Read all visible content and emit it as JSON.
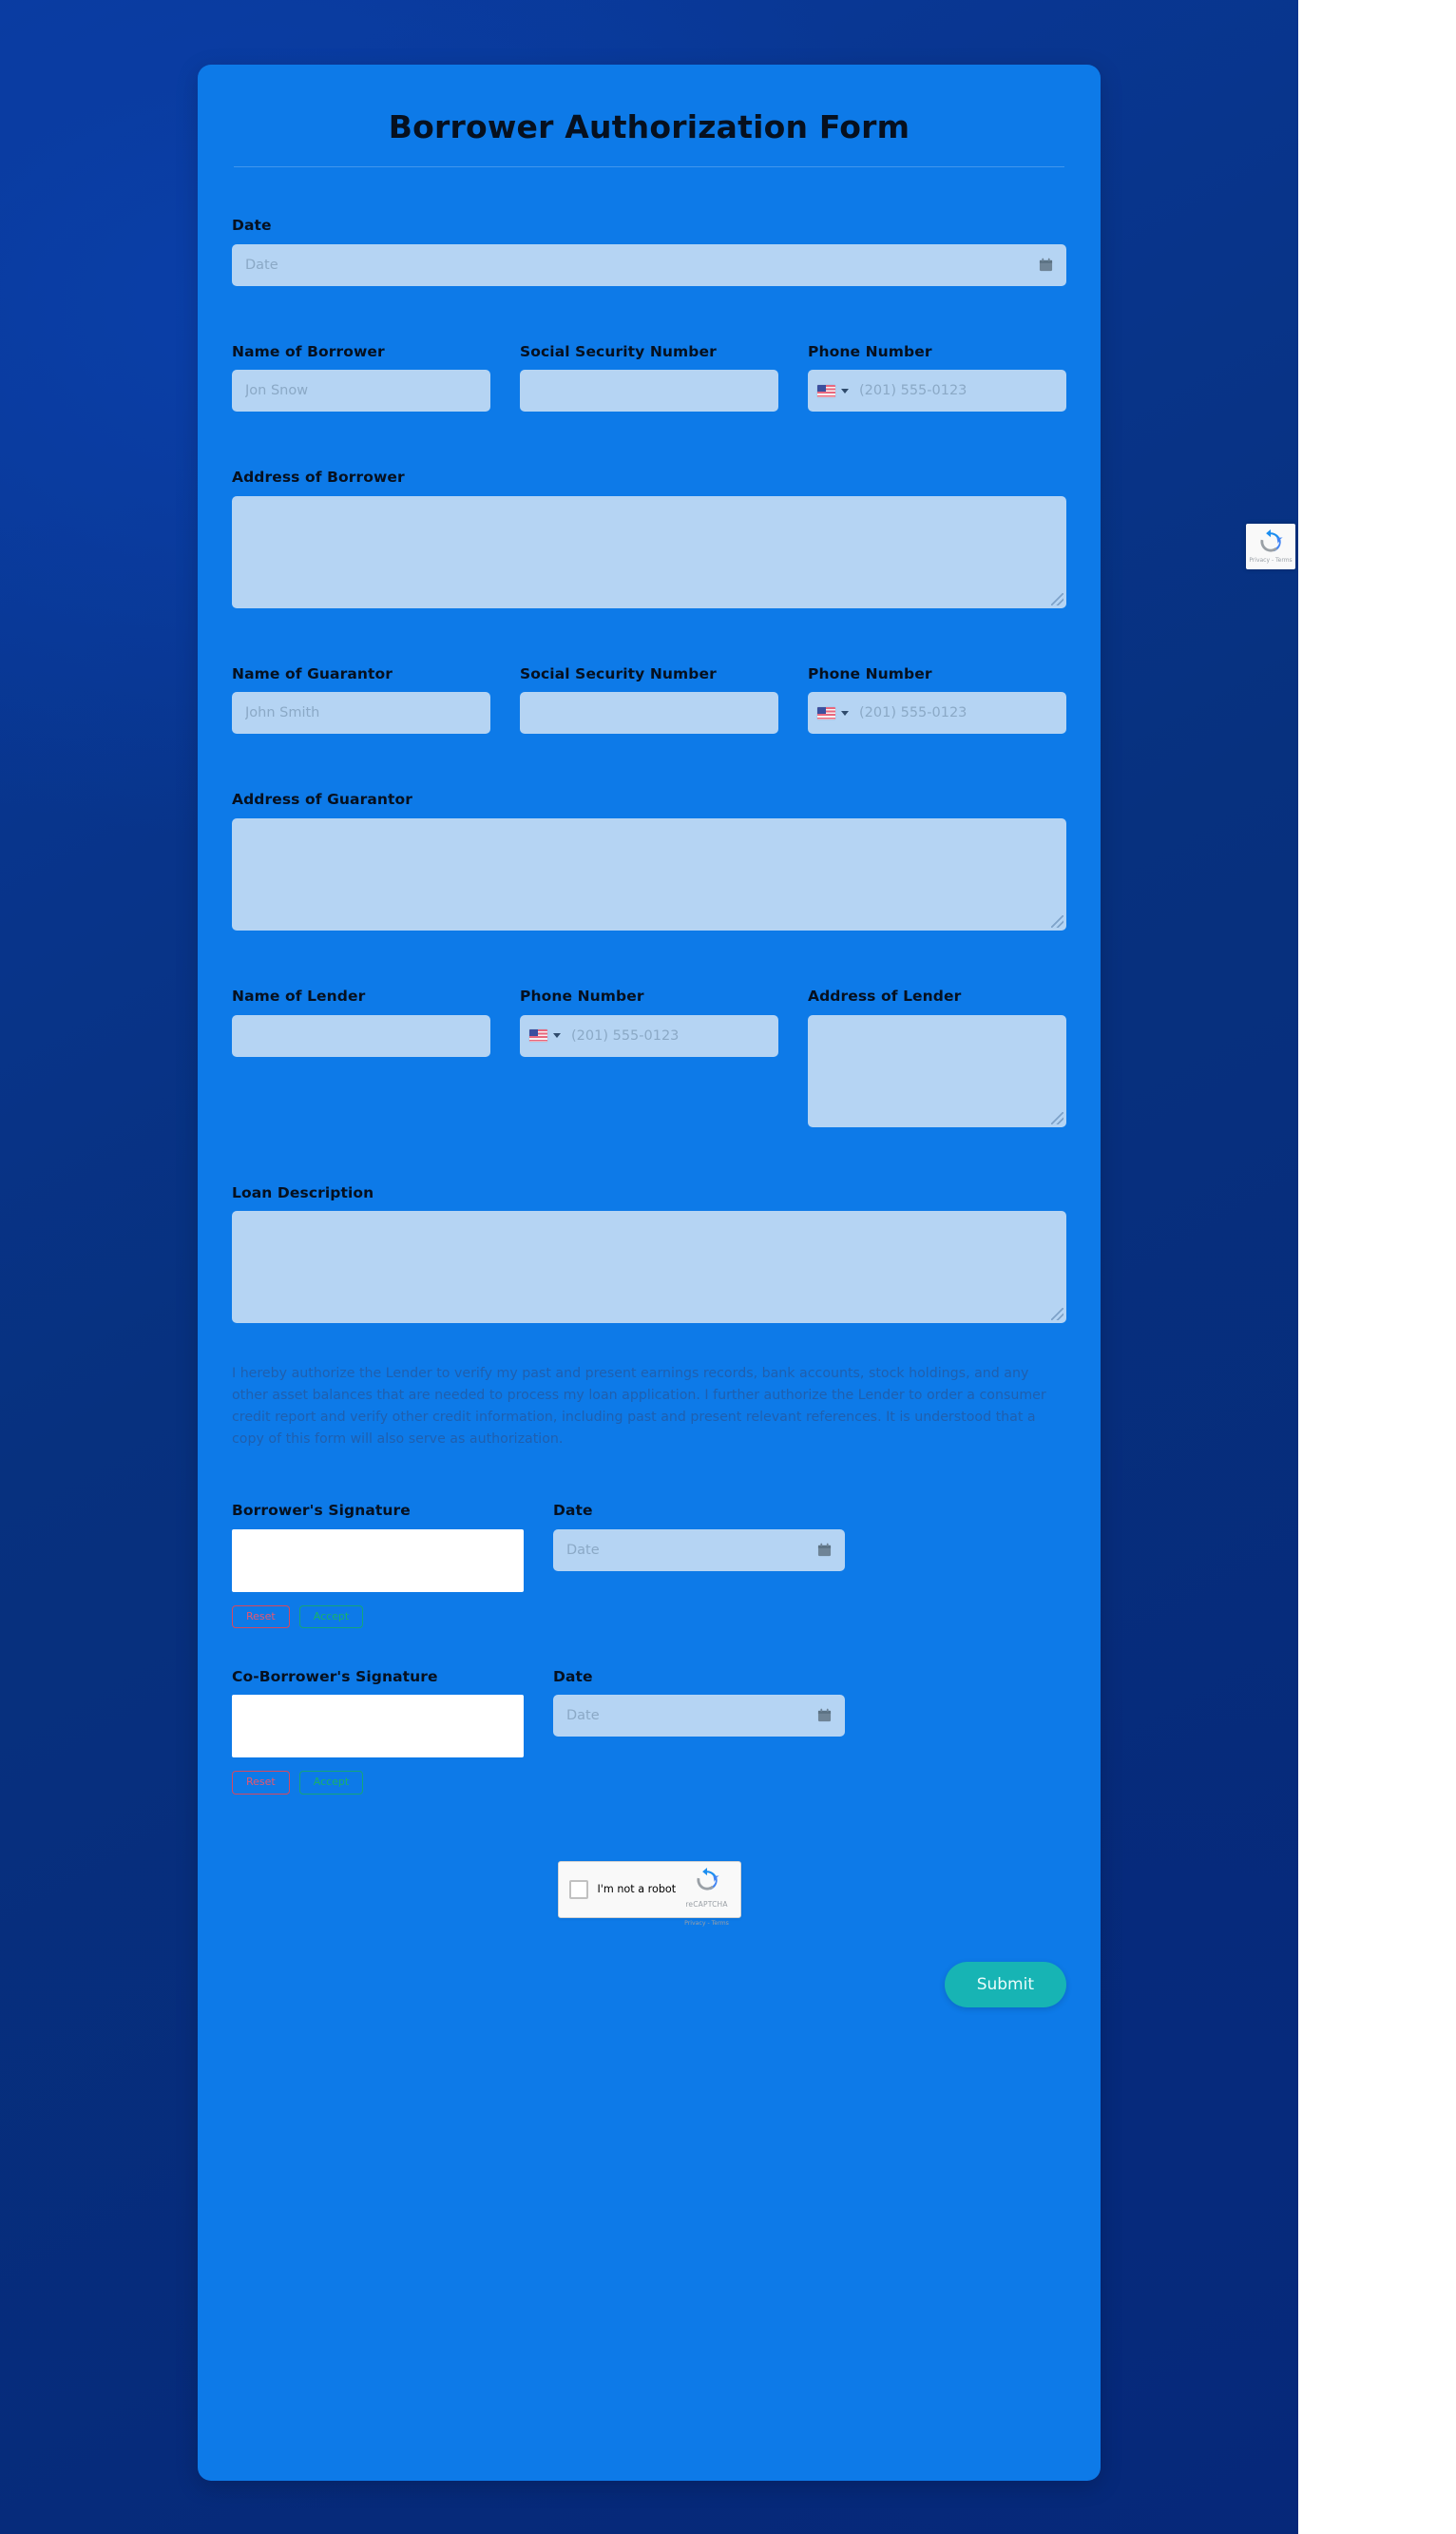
{
  "form": {
    "title": "Borrower Authorization Form",
    "date": {
      "label": "Date",
      "placeholder": "Date",
      "value": "",
      "icon": "calendar-icon"
    },
    "borrower": {
      "name_label": "Name of Borrower",
      "name_placeholder": "Jon Snow",
      "name_value": "",
      "ssn_label": "Social Security Number",
      "ssn_placeholder": "",
      "ssn_value": "",
      "phone_label": "Phone Number",
      "phone_placeholder": "(201) 555-0123",
      "phone_value": "",
      "phone_country_icon": "us-flag-icon",
      "address_label": "Address of Borrower",
      "address_value": ""
    },
    "guarantor": {
      "name_label": "Name of Guarantor",
      "name_placeholder": "John Smith",
      "name_value": "",
      "ssn_label": "Social Security Number",
      "ssn_placeholder": "",
      "ssn_value": "",
      "phone_label": "Phone Number",
      "phone_placeholder": "(201) 555-0123",
      "phone_value": "",
      "phone_country_icon": "us-flag-icon",
      "address_label": "Address of Guarantor",
      "address_value": ""
    },
    "lender": {
      "name_label": "Name of Lender",
      "name_placeholder": "",
      "name_value": "",
      "phone_label": "Phone Number",
      "phone_placeholder": "(201) 555-0123",
      "phone_value": "",
      "phone_country_icon": "us-flag-icon",
      "address_label": "Address of Lender",
      "address_value": ""
    },
    "loan": {
      "description_label": "Loan Description",
      "description_value": ""
    },
    "authorization_text": "I hereby authorize the Lender to verify my past and present earnings records, bank accounts, stock holdings, and any other asset balances that are needed to process my loan application. I further authorize the Lender to order a consumer credit report and verify other credit information, including past and present relevant references. It is understood that a copy of this form will also serve as authorization.",
    "borrower_signature": {
      "label": "Borrower's Signature",
      "reset_label": "Reset",
      "accept_label": "Accept",
      "date_label": "Date",
      "date_placeholder": "Date",
      "date_value": ""
    },
    "coborrower_signature": {
      "label": "Co-Borrower's Signature",
      "reset_label": "Reset",
      "accept_label": "Accept",
      "date_label": "Date",
      "date_placeholder": "Date",
      "date_value": ""
    },
    "recaptcha": {
      "label": "I'm not a robot",
      "brand": "reCAPTCHA",
      "terms": "Privacy - Terms",
      "badge_terms": "Privacy - Terms",
      "logo_icon": "recaptcha-logo-icon"
    },
    "submit_label": "Submit"
  },
  "colors": {
    "page_background_dark": "#07317f",
    "card_background": "#0d7ae8",
    "input_background": "#b5d4f3",
    "label_text": "#06101f",
    "placeholder_text": "#8ba9c6",
    "authorization_text": "#1f5fae",
    "submit_button": "#17b4b4",
    "reset_button_border": "#d6485f",
    "accept_button_border": "#14a57a",
    "signature_pad": "#ffffff"
  }
}
